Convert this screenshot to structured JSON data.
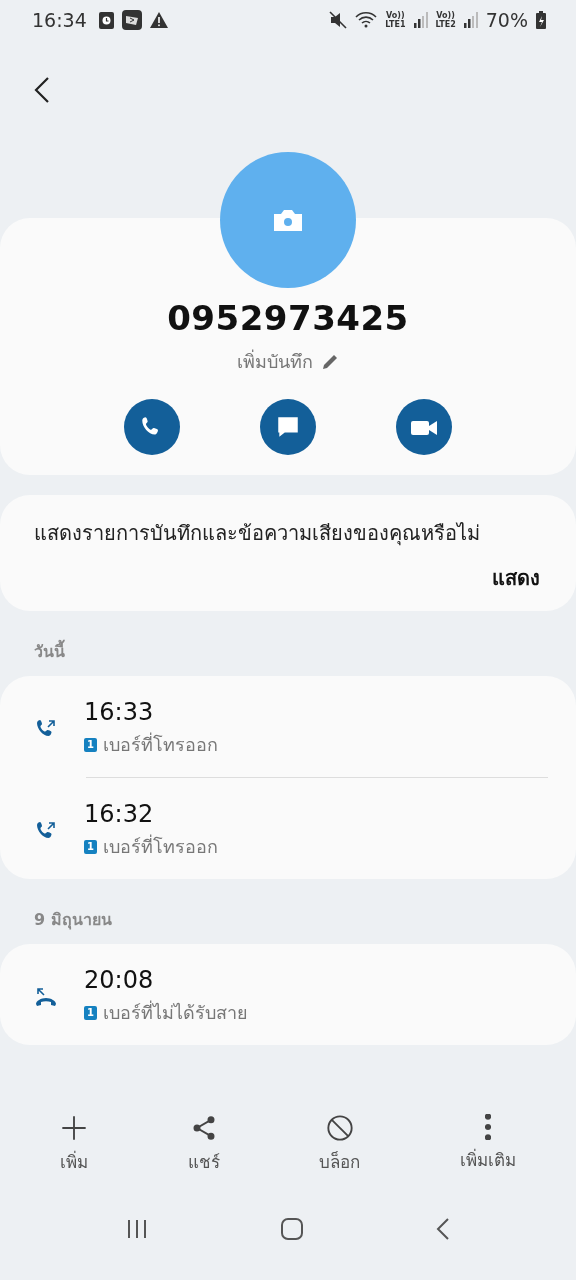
{
  "status_bar": {
    "time": "16:34",
    "sim_labels": [
      {
        "top": "Vo))",
        "bottom": "LTE1"
      },
      {
        "top": "Vo))",
        "bottom": "LTE2"
      }
    ],
    "battery": "70%"
  },
  "contact": {
    "number": "0952973425",
    "note_link": "เพิ่มบันทึก"
  },
  "banner": {
    "text": "แสดงรายการบันทึกและข้อความเสียงของคุณหรือไม่",
    "action": "แสดง"
  },
  "call_groups": [
    {
      "heading": "วันนี้",
      "calls": [
        {
          "kind": "outgoing",
          "time": "16:33",
          "sim": "1",
          "label": "เบอร์ที่โทรออก"
        },
        {
          "kind": "outgoing",
          "time": "16:32",
          "sim": "1",
          "label": "เบอร์ที่โทรออก"
        }
      ]
    },
    {
      "heading": "9 มิถุนายน",
      "calls": [
        {
          "kind": "missed",
          "time": "20:08",
          "sim": "1",
          "label": "เบอร์ที่ไม่ได้รับสาย"
        }
      ]
    }
  ],
  "bottom_actions": [
    {
      "kind": "add",
      "label": "เพิ่ม"
    },
    {
      "kind": "share",
      "label": "แชร์"
    },
    {
      "kind": "block",
      "label": "บล็อก"
    },
    {
      "kind": "more",
      "label": "เพิ่มเติม"
    }
  ]
}
